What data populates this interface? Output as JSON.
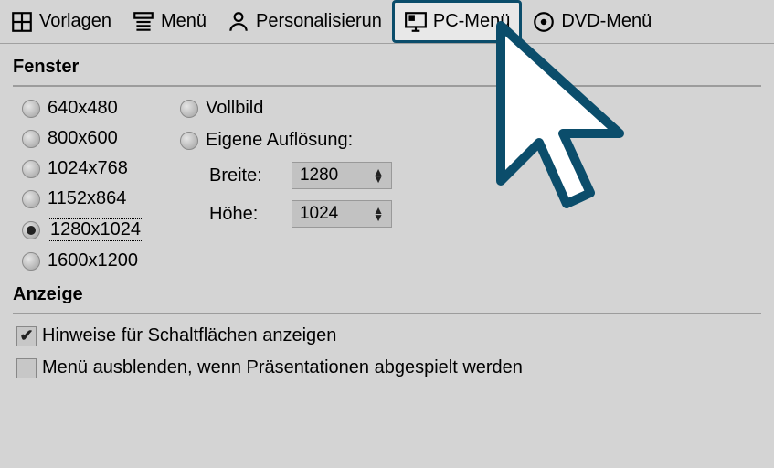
{
  "toolbar": {
    "items": [
      {
        "label": "Vorlagen"
      },
      {
        "label": "Menü"
      },
      {
        "label": "Personalisierun"
      },
      {
        "label": "PC-Menü"
      },
      {
        "label": "DVD-Menü"
      }
    ]
  },
  "sections": {
    "fenster": {
      "title": "Fenster",
      "resolutions": [
        "640x480",
        "800x600",
        "1024x768",
        "1152x864",
        "1280x1024",
        "1600x1200"
      ],
      "selected": "1280x1024",
      "fullscreen": "Vollbild",
      "customRes": "Eigene Auflösung:",
      "widthLabel": "Breite:",
      "heightLabel": "Höhe:",
      "widthValue": "1280",
      "heightValue": "1024"
    },
    "anzeige": {
      "title": "Anzeige",
      "opt1": "Hinweise für Schaltflächen anzeigen",
      "opt2": "Menü ausblenden, wenn Präsentationen abgespielt werden",
      "opt1_checked": true,
      "opt2_checked": false
    }
  }
}
